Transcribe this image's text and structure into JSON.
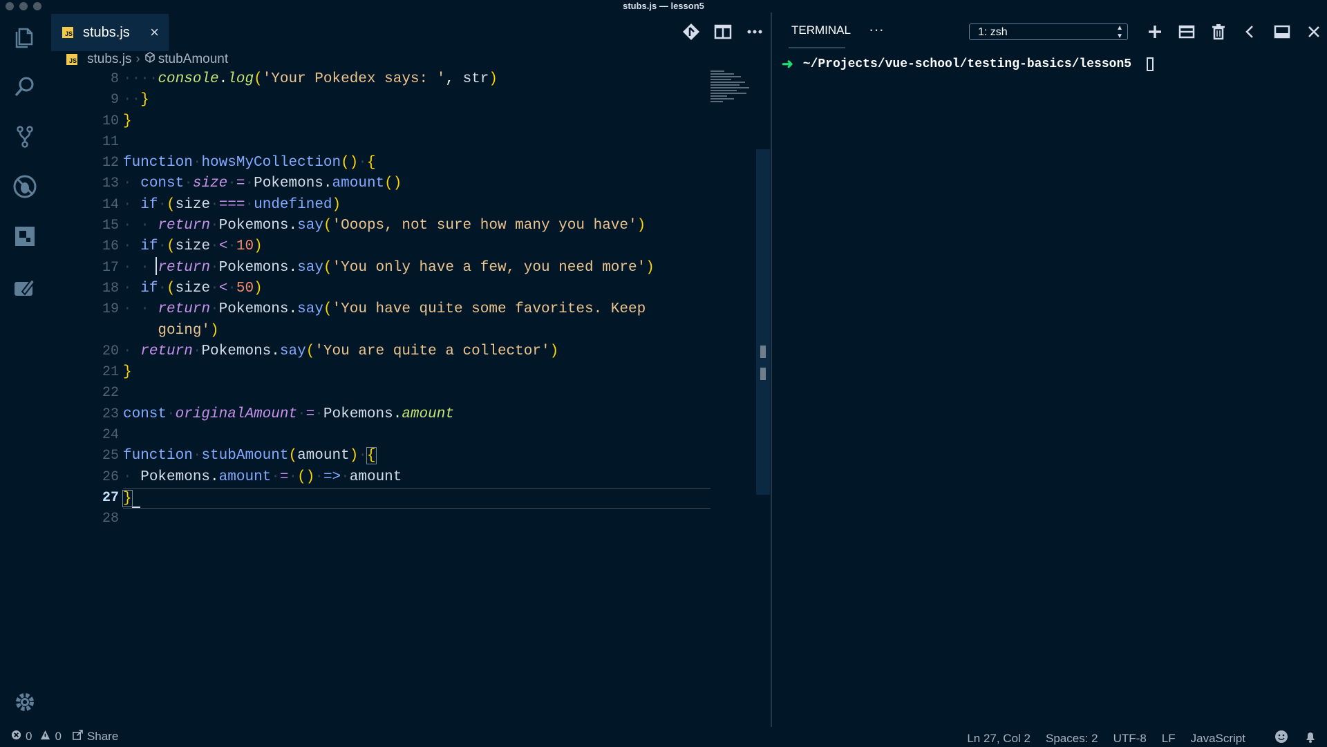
{
  "window": {
    "title": "stubs.js — lesson5"
  },
  "activity_bar": {
    "icons": [
      "files-icon",
      "search-icon",
      "source-control-icon",
      "debug-icon",
      "extensions-icon",
      "remote-icon"
    ],
    "settings_icon": "gear-icon"
  },
  "tabs": [
    {
      "badge": "JS",
      "label": "stubs.js",
      "close": "×"
    }
  ],
  "editor_actions": [
    "git-compare-icon",
    "split-editor-icon",
    "more-actions-icon"
  ],
  "breadcrumb": {
    "file_badge": "JS",
    "file": "stubs.js",
    "separator": "›",
    "symbol_icon": "symbol-method-icon",
    "symbol": "stubAmount"
  },
  "editor": {
    "line_numbers": [
      "8",
      "9",
      "10",
      "11",
      "12",
      "13",
      "14",
      "15",
      "16",
      "17",
      "18",
      "19",
      "",
      "20",
      "21",
      "22",
      "23",
      "24",
      "25",
      "26",
      "27",
      "28"
    ],
    "active_line": "27",
    "code": {
      "l8_console": "console",
      "l8_log": "log",
      "l8_str": "'Your Pokedex says: '",
      "l8_arg": "str",
      "l12_kw": "function",
      "l12_name": "howsMyCollection",
      "l13_kw": "const",
      "l13_var": "size",
      "l13_obj": "Pokemons",
      "l13_method": "amount",
      "l14_kw": "if",
      "l14_var": "size",
      "l14_op": "===",
      "l14_val": "undefined",
      "ret": "return",
      "obj": "Pokemons",
      "say": "say",
      "l15_str": "'Ooops, not sure how many you have'",
      "l16_num": "10",
      "l17_str": "'You only have a few, you need more'",
      "l18_num": "50",
      "l19_str": "'You have quite some favorites. Keep",
      "l19b_str": "going'",
      "l20_str": "'You are quite a collector'",
      "l23_kw": "const",
      "l23_var": "originalAmount",
      "l23_obj": "Pokemons",
      "l23_prop": "amount",
      "l25_kw": "function",
      "l25_name": "stubAmount",
      "l25_param": "amount",
      "l26_obj": "Pokemons",
      "l26_prop": "amount",
      "l26_arrow": "=>",
      "l26_val": "amount"
    }
  },
  "panel": {
    "tab": "TERMINAL",
    "more": "···",
    "terminal_select": "1: zsh",
    "actions": [
      "add-terminal-icon",
      "split-terminal-icon",
      "trash-icon",
      "chevron-left-icon",
      "maximize-panel-icon",
      "close-icon"
    ],
    "prompt": "➜",
    "cwd": "~/Projects/vue-school/testing-basics/lesson5"
  },
  "status_bar": {
    "errors": "0",
    "warnings": "0",
    "share": "Share",
    "position": "Ln 27, Col 2",
    "spaces": "Spaces: 2",
    "encoding": "UTF-8",
    "eol": "LF",
    "language": "JavaScript"
  }
}
